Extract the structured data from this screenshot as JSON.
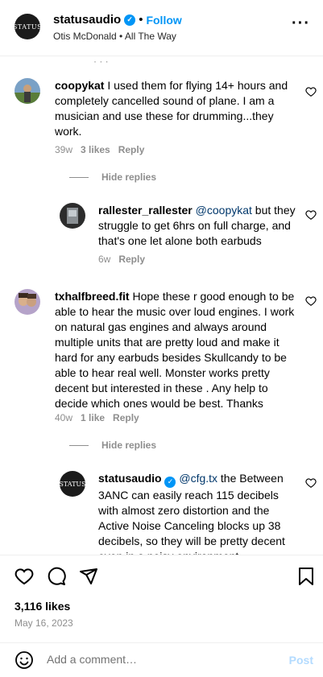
{
  "post": {
    "username": "statusaudio",
    "follow_label": "Follow",
    "subtitle": "Otis McDonald • All The Way",
    "avatar_text": "STATUS"
  },
  "comments": [
    {
      "username": "coopykat",
      "text": "I used them for flying 14+ hours and completely cancelled sound of plane. I am a musician and use these for drumming...they work.",
      "time": "39w",
      "likes": "3 likes",
      "reply_label": "Reply"
    },
    {
      "hide_replies_label": "Hide replies"
    },
    {
      "username": "rallester_rallester",
      "mention": "@coopykat",
      "text": " but they struggle to get 6hrs on full charge, and that's one let alone both earbuds",
      "time": "6w",
      "reply_label": "Reply"
    },
    {
      "username": "txhalfbreed.fit",
      "text": "Hope these r good enough to be able to hear the music over loud engines. I work on natural gas engines and always around multiple units that are pretty loud and make it hard for any earbuds besides Skullcandy to be able to hear real well. Monster works pretty decent but interested in these . Any help to decide which ones would be best. Thanks",
      "time": "40w",
      "likes": "1 like",
      "reply_label": "Reply"
    },
    {
      "hide_replies_label": "Hide replies"
    },
    {
      "username": "statusaudio",
      "mention": "@cfg.tx",
      "text": " the Between 3ANC can easily reach 115 decibels with almost zero distortion and the Active Noise Canceling blocks up 38 decibels, so they will be pretty decent even in a noisy environment",
      "avatar_text": "STATUS"
    }
  ],
  "actions": {
    "likes": "3,116 likes",
    "date": "May 16, 2023"
  },
  "add_comment": {
    "placeholder": "Add a comment…",
    "post_label": "Post"
  }
}
